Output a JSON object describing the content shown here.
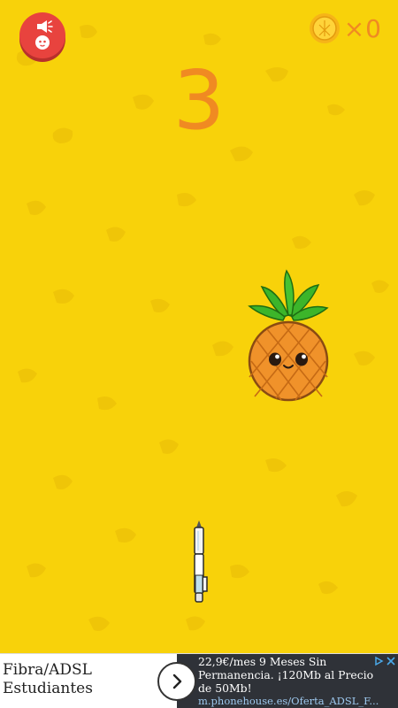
{
  "hud": {
    "sound_button_icon": "speaker-face-icon",
    "coin_icon": "coin-icon",
    "coin_multiplier": "×0",
    "score": "3"
  },
  "game": {
    "target": "pineapple-character",
    "projectile": "pen"
  },
  "ad": {
    "title_line1": "Fibra/ADSL",
    "title_line2": "Estudiantes",
    "description": "22,9€/mes 9 Meses Sin Permanencia. ¡120Mb al Precio de 50Mb!",
    "url": "m.phonehouse.es/Oferta_ADSL_F...",
    "arrow_icon": "chevron-right-icon",
    "adchoices_icon": "adchoices-icon",
    "close_icon": "close-icon"
  },
  "colors": {
    "background": "#f8d20a",
    "accent_orange": "#f08a22",
    "sound_button": "#e8433e"
  }
}
